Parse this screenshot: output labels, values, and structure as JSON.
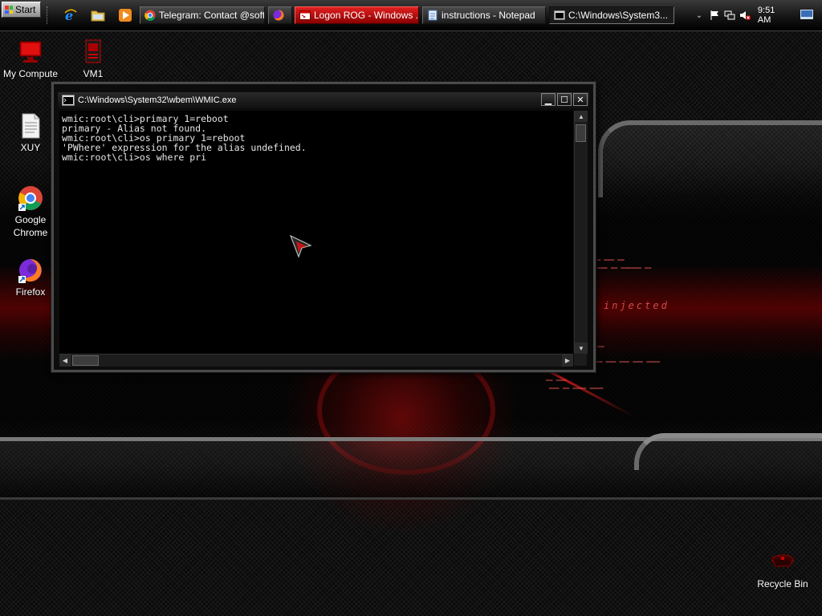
{
  "taskbar": {
    "start_label": "Start",
    "tasks": [
      {
        "label": "Telegram: Contact @soft..."
      },
      {
        "label": ""
      },
      {
        "label": "Logon ROG - Windows ..."
      },
      {
        "label": "instructions - Notepad"
      },
      {
        "label": "C:\\Windows\\System3..."
      }
    ],
    "clock": "9:51 AM"
  },
  "desktop": {
    "icons": [
      {
        "label": "My Compute"
      },
      {
        "label": "VM1"
      },
      {
        "label": "XUY"
      },
      {
        "label": "Google Chrome"
      },
      {
        "label": "Firefox"
      },
      {
        "label": "Recycle Bin"
      }
    ]
  },
  "console": {
    "title": "C:\\Windows\\System32\\wbem\\WMIC.exe",
    "lines": [
      "wmic:root\\cli>primary 1=reboot",
      "primary - Alias not found.",
      "wmic:root\\cli>os primary 1=reboot",
      "'PWhere' expression for the alias undefined.",
      "wmic:root\\cli>os where pri"
    ]
  },
  "wallpaper": {
    "text": "injected"
  },
  "colors": {
    "accent_red": "#d01010",
    "taskbar": "#151515",
    "console_bg": "#000000"
  }
}
